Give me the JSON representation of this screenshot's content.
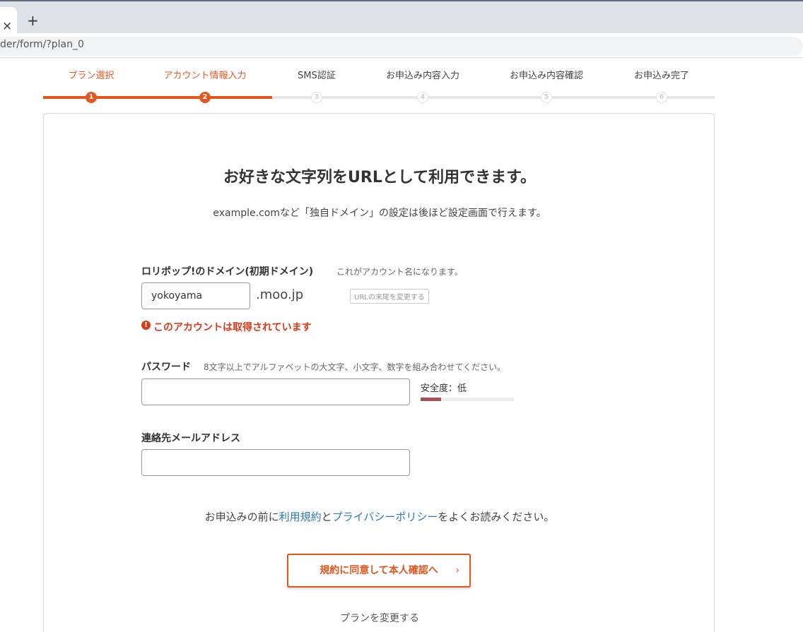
{
  "browser": {
    "url": "der/form/?plan_0",
    "tab_close": "×",
    "new_tab": "+"
  },
  "steps": [
    {
      "label": "プラン選択",
      "num": "1",
      "state": "done"
    },
    {
      "label": "アカウント情報入力",
      "num": "2",
      "state": "current"
    },
    {
      "label": "SMS認証",
      "num": "3",
      "state": "pending"
    },
    {
      "label": "お申込み内容入力",
      "num": "4",
      "state": "pending"
    },
    {
      "label": "お申込み内容確認",
      "num": "5",
      "state": "pending"
    },
    {
      "label": "お申込み完了",
      "num": "6",
      "state": "pending"
    }
  ],
  "main": {
    "headline": "お好きな文字列をURLとして利用できます。",
    "subtext": "example.comなど「独自ドメイン」の設定は後ほど設定画面で行えます。"
  },
  "domain": {
    "label": "ロリポップ!のドメイン(初期ドメイン)",
    "note": "これがアカウント名になります。",
    "value": "yokoyama",
    "suffix": ".moo.jp",
    "change_suffix_button": "URLの末尾を変更する",
    "error_icon": "!",
    "error": "このアカウントは取得されています"
  },
  "password": {
    "label": "パスワード",
    "note": "8文字以上でアルファベットの大文字、小文字、数字を組み合わせてください。",
    "value": "",
    "strength_label": "安全度：低",
    "strength_fraction": 0.22,
    "strength_color": "#a8505a"
  },
  "email": {
    "label": "連絡先メールアドレス",
    "value": ""
  },
  "terms": {
    "prefix": "お申込みの前に",
    "terms_link": "利用規約",
    "and": "と",
    "privacy_link": "プライバシーポリシー",
    "suffix": "をよくお読みください。"
  },
  "cta": {
    "label": "規約に同意して本人確認へ",
    "arrow": "›"
  },
  "change_plan": "プランを変更する",
  "colors": {
    "accent": "#e3561d",
    "error": "#d93b1b",
    "link": "#2a7ab0"
  }
}
